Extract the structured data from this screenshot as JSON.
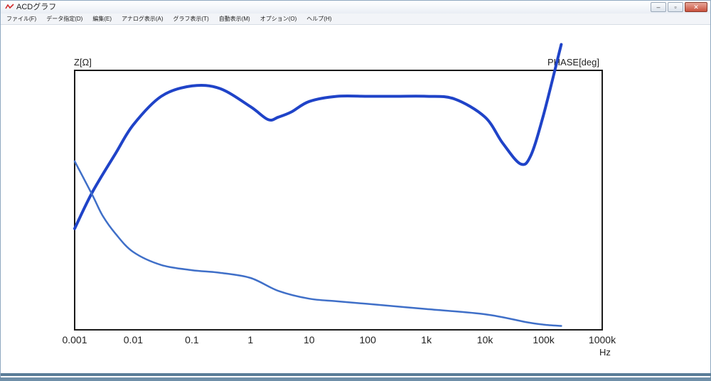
{
  "window": {
    "title": "ACDグラフ",
    "controls": {
      "minimize": "–",
      "maximize": "▫",
      "close": "✕"
    }
  },
  "menu": [
    "ファイル(F)",
    "データ指定(D)",
    "編集(E)",
    "アナログ表示(A)",
    "グラフ表示(T)",
    "自動表示(M)",
    "オプション(O)",
    "ヘルプ(H)"
  ],
  "chart_data": {
    "type": "line",
    "xscale": "log",
    "xlim": [
      0.001,
      1000000
    ],
    "ylim": [
      0,
      100
    ],
    "xticks": [
      "0.001",
      "0.01",
      "0.1",
      "1",
      "10",
      "100",
      "1k",
      "10k",
      "100k",
      "1000k"
    ],
    "xunit": "Hz",
    "ylabel_left": "Z[Ω]",
    "ylabel_right": "PHASE[deg]",
    "series": [
      {
        "color": "#1f43c8",
        "x": [
          0.001,
          0.002,
          0.005,
          0.01,
          0.03,
          0.1,
          0.3,
          1,
          2,
          3,
          5,
          10,
          30,
          100,
          300,
          1000,
          3000,
          10000,
          20000,
          40000,
          60000,
          100000,
          200000
        ],
        "y": [
          39,
          53,
          68,
          79,
          90,
          94,
          93,
          86,
          81,
          82,
          84,
          88,
          90,
          90,
          90,
          90,
          89,
          82,
          72,
          64,
          67,
          83,
          110
        ]
      },
      {
        "color": "#3f6fc8",
        "x": [
          0.001,
          0.002,
          0.003,
          0.005,
          0.01,
          0.03,
          0.1,
          0.3,
          1,
          3,
          10,
          30,
          100,
          1000,
          10000,
          50000,
          100000,
          200000
        ],
        "y": [
          65,
          52,
          44,
          37,
          30,
          25,
          23,
          22,
          20,
          15,
          12,
          11,
          10,
          8,
          6,
          3,
          2,
          1.5
        ]
      }
    ]
  }
}
